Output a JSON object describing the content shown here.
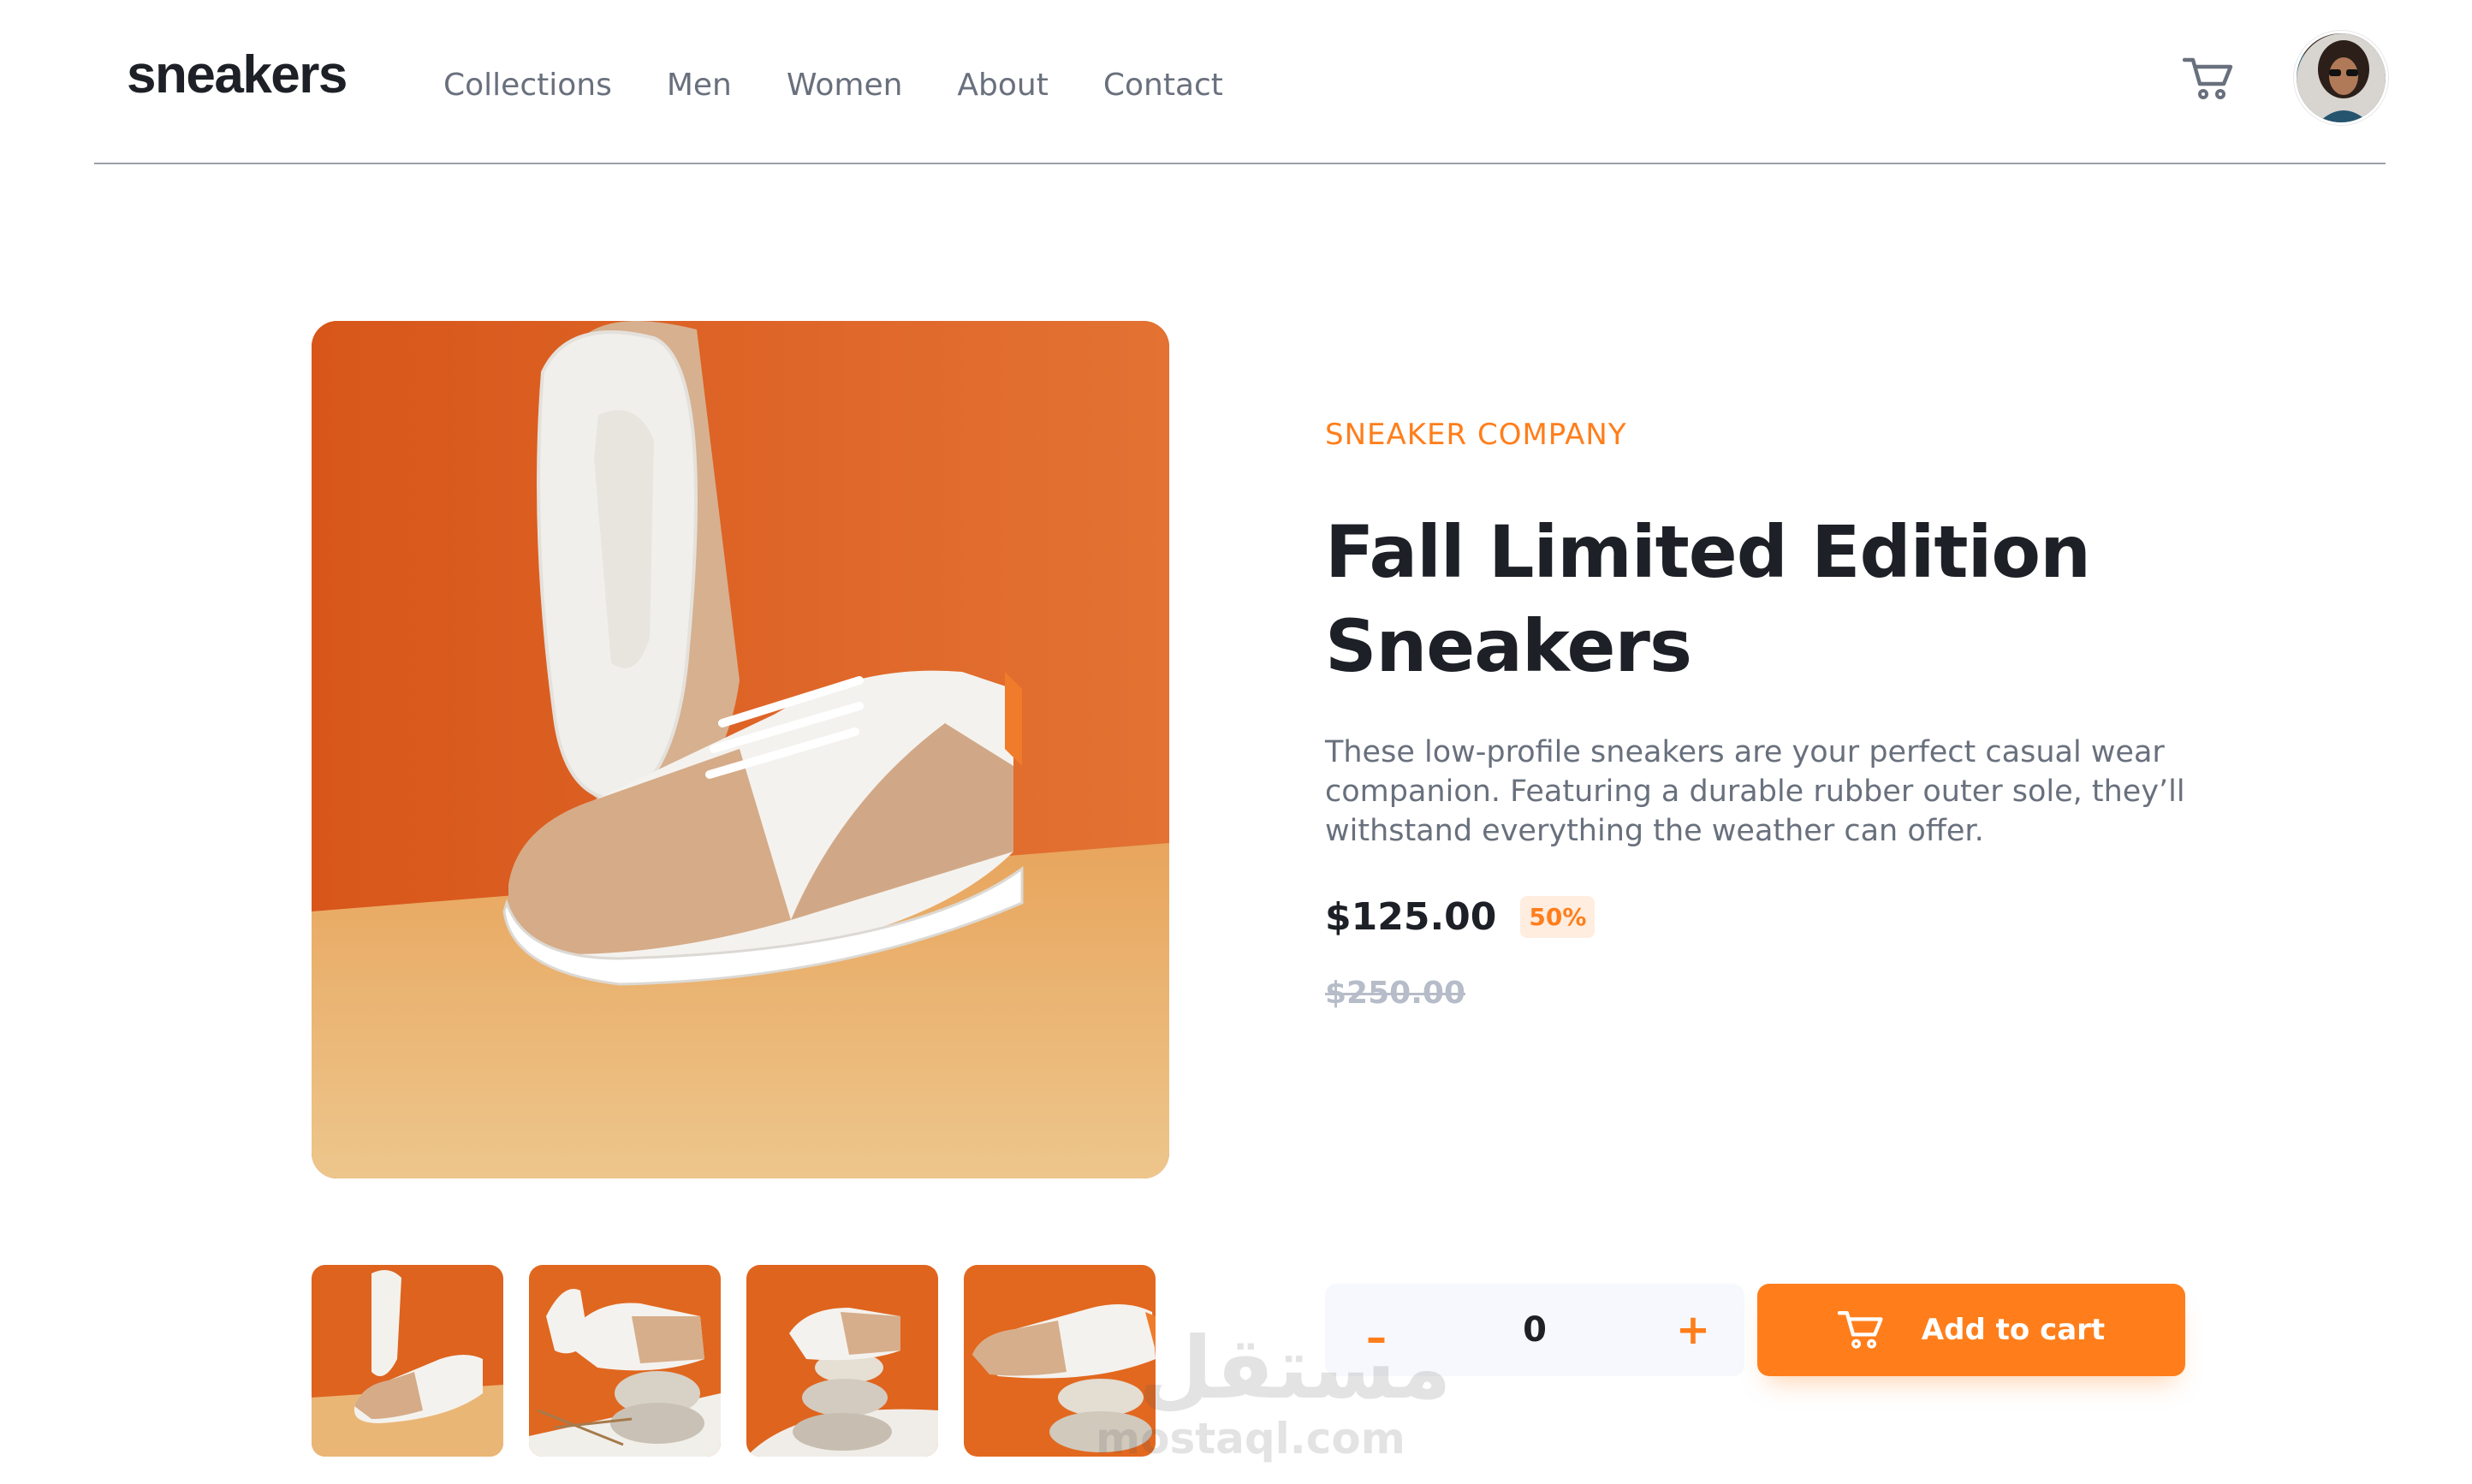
{
  "header": {
    "logo": "sneakers",
    "nav": [
      "Collections",
      "Men",
      "Women",
      "About",
      "Contact"
    ],
    "cart_icon": "cart-icon",
    "avatar_icon": "user-avatar"
  },
  "product": {
    "company": "SNEAKER COMPANY",
    "title": "Fall Limited Edition Sneakers",
    "description": "These low-profile sneakers are your perfect casual wear companion. Featuring a durable rubber outer sole, they’ll withstand everything the weather can offer.",
    "price": "$125.00",
    "discount": "50%",
    "original_price": "$250.00"
  },
  "cart_controls": {
    "minus": "–",
    "quantity": "0",
    "plus": "+",
    "add_label": "Add to cart"
  },
  "watermark": {
    "arabic": "مستقل",
    "latin": "mostaql.com"
  },
  "colors": {
    "accent": "#ff7e1b",
    "accent_pale": "#ffede0",
    "text_dark": "#1d2026",
    "text_gray": "#69707d"
  }
}
